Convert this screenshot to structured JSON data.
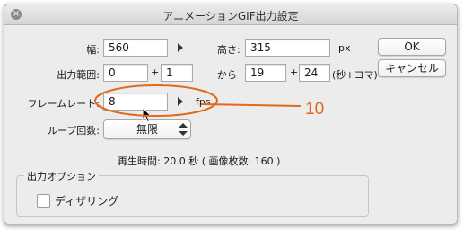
{
  "window": {
    "title": "アニメーションGIF出力設定",
    "close_icon": "×"
  },
  "size": {
    "width_label": "幅:",
    "width_value": "560",
    "height_label": "高さ:",
    "height_value": "315",
    "unit": "px"
  },
  "range": {
    "label": "出力範囲:",
    "start_sec": "0",
    "plus1": "+",
    "start_frame": "1",
    "from_label": "から",
    "end_sec": "19",
    "plus2": "+",
    "end_frame": "24",
    "unit": "(秒+コマ)"
  },
  "frame_rate": {
    "label": "フレームレート:",
    "value": "8",
    "unit": "fps"
  },
  "loop": {
    "label": "ループ回数:",
    "value": "無限"
  },
  "playback_info": "再生時間: 20.0 秒 ( 画像枚数: 160 )",
  "output_options": {
    "title": "出力オプション",
    "dither_label": "ディザリング",
    "dither_checked": false
  },
  "buttons": {
    "ok": "OK",
    "cancel": "キャンセル"
  },
  "annotation": {
    "label": "10",
    "color": "#e06a1b"
  }
}
